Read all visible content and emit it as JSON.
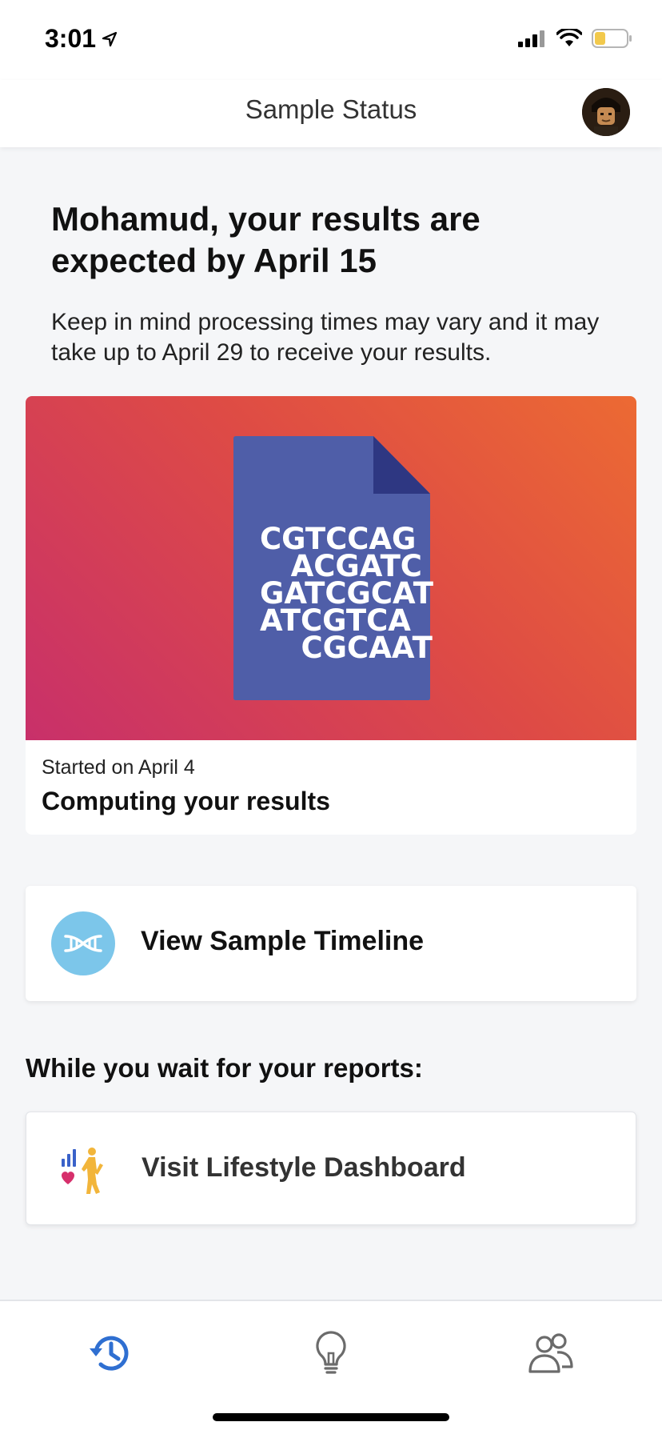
{
  "status_bar": {
    "time": "3:01",
    "location_icon": "location-arrow-icon",
    "signal_icon": "cellular-signal-icon",
    "wifi_icon": "wifi-icon",
    "battery_icon": "battery-icon",
    "battery_color": "#f2c94c"
  },
  "nav": {
    "title": "Sample Status",
    "avatar_icon": "profile-avatar"
  },
  "main": {
    "headline": "Mohamud, your results are expected by April 15",
    "subtext": "Keep in mind processing times may vary and it may take up to April 29 to receive your results.",
    "status_card": {
      "dna_lines": [
        "CGTCCAG",
        "   ACGATC",
        "GATCGCAT",
        "ATCGTCA",
        "    CGCAAT"
      ],
      "started": "Started on April 4",
      "status": "Computing your results",
      "gradient": [
        "#ec6a33",
        "#de4b45",
        "#c8306a"
      ],
      "document_color": "#4f5ea8"
    },
    "timeline": {
      "icon": "dna-icon",
      "label": "View Sample Timeline",
      "icon_color": "#7cc6ea"
    },
    "section_heading": "While you wait for your reports:",
    "lifestyle": {
      "icon": "lifestyle-walker-icon",
      "label": "Visit Lifestyle Dashboard"
    }
  },
  "tab_bar": {
    "tabs": [
      {
        "icon": "history-icon",
        "active": true
      },
      {
        "icon": "lightbulb-icon",
        "active": false
      },
      {
        "icon": "people-icon",
        "active": false
      }
    ],
    "active_color": "#2f6fd1",
    "inactive_color": "#6b6b6b"
  }
}
